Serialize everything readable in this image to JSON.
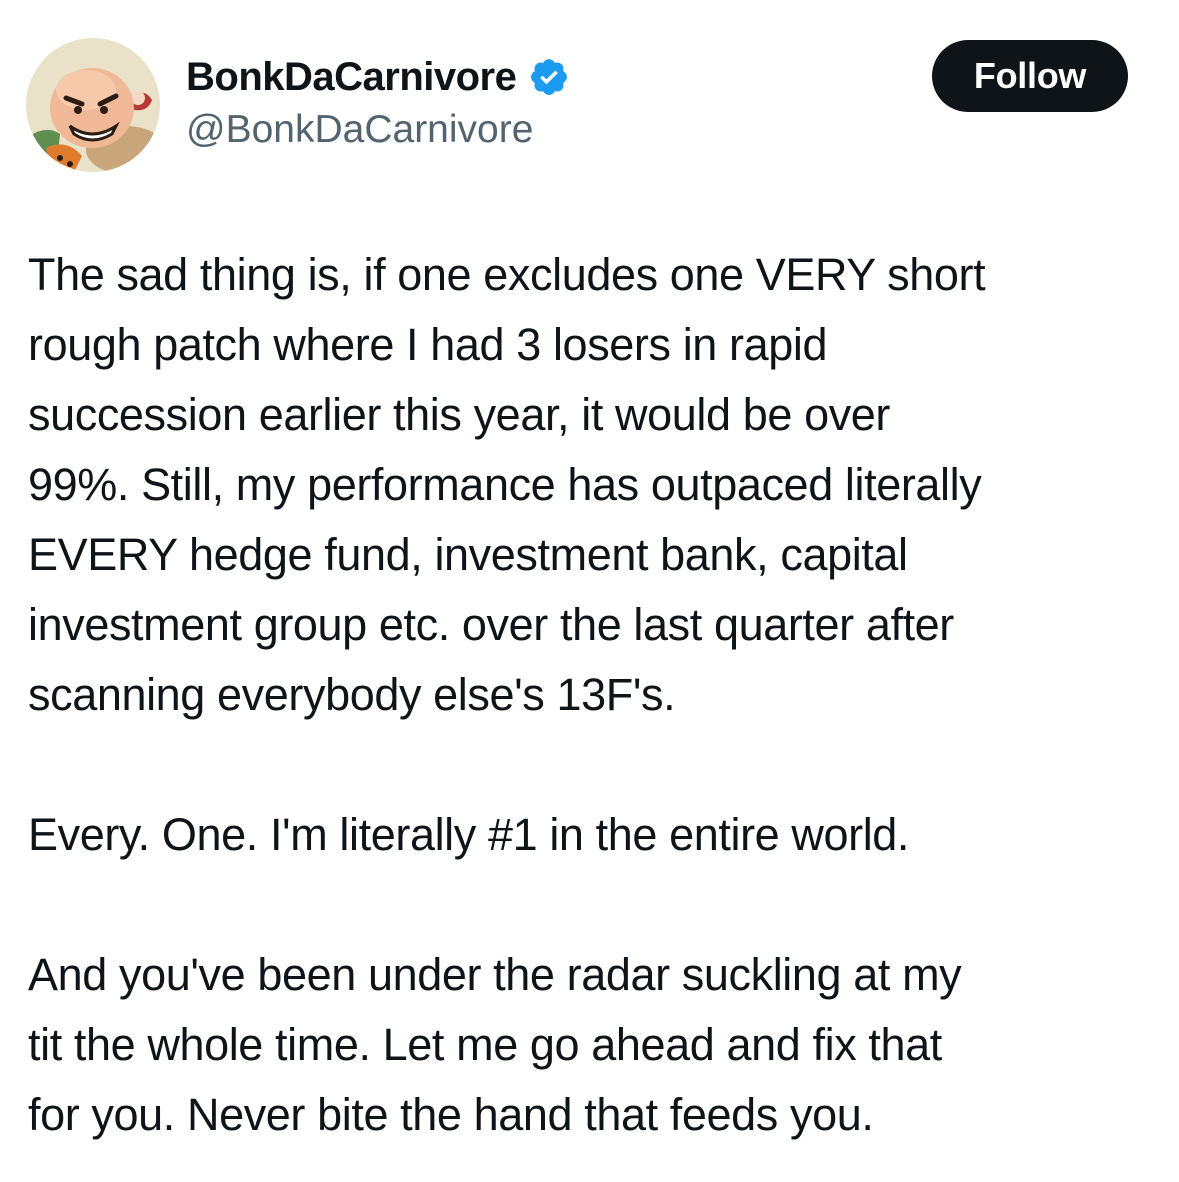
{
  "author": {
    "display_name": "BonkDaCarnivore",
    "handle": "@BonkDaCarnivore",
    "verified_icon": "verified-badge-icon",
    "verified_color": "#1d9bf0",
    "avatar_icon": "cartoon-caveman-avatar"
  },
  "actions": {
    "follow_label": "Follow"
  },
  "tweet": {
    "paragraphs": [
      "The sad thing is, if one excludes one VERY short\nrough patch where I had 3 losers in rapid\nsuccession earlier this year, it would be over\n99%.  Still, my performance has outpaced literally\nEVERY hedge fund, investment bank, capital\ninvestment group etc. over the last quarter after\nscanning everybody else's 13F's.",
      "Every. One.  I'm literally #1 in the entire world.",
      "And you've been under the radar suckling at my\ntit the whole time.  Let me go ahead and fix that\nfor you.  Never bite the hand that feeds you."
    ]
  },
  "colors": {
    "text": "#0f1419",
    "secondary_text": "#536471",
    "button_bg": "#0f1419",
    "button_text": "#ffffff"
  }
}
